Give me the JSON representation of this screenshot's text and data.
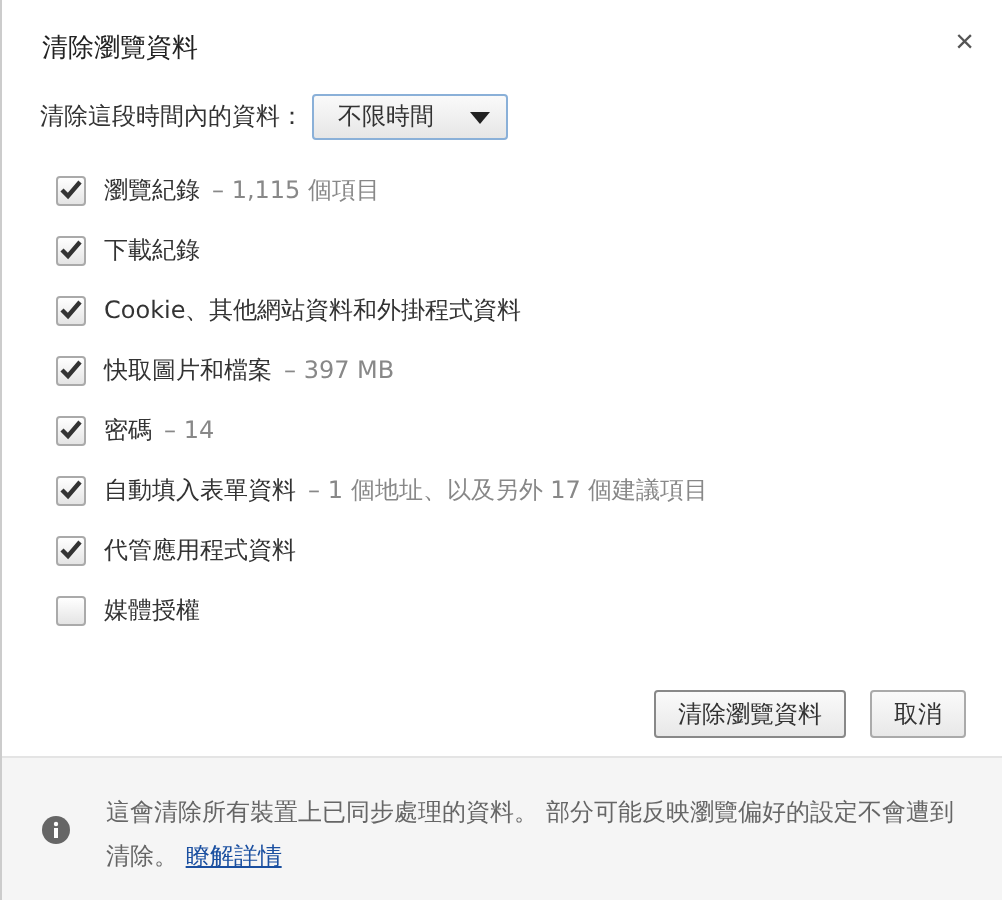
{
  "dialog": {
    "title": "清除瀏覽資料",
    "close": "×"
  },
  "range": {
    "label": "清除這段時間內的資料：",
    "value": "不限時間"
  },
  "items": [
    {
      "label": "瀏覽紀錄",
      "detail": "– 1,115 個項目",
      "checked": true
    },
    {
      "label": "下載紀錄",
      "checked": true
    },
    {
      "label": "Cookie、其他網站資料和外掛程式資料",
      "checked": true
    },
    {
      "label": "快取圖片和檔案",
      "detail": "– 397 MB",
      "checked": true
    },
    {
      "label": "密碼",
      "detail": "– 14",
      "checked": true
    },
    {
      "label": "自動填入表單資料",
      "detail": "– 1 個地址、以及另外 17 個建議項目",
      "checked": true
    },
    {
      "label": "代管應用程式資料",
      "checked": true
    },
    {
      "label": "媒體授權",
      "checked": false
    }
  ],
  "buttons": [
    {
      "label": "清除瀏覽資料"
    },
    {
      "label": "取消"
    }
  ],
  "footer": {
    "text": "這會清除所有裝置上已同步處理的資料。 部分可能反映瀏覽偏好的設定不會遭到清除。",
    "link": "瞭解詳情"
  }
}
